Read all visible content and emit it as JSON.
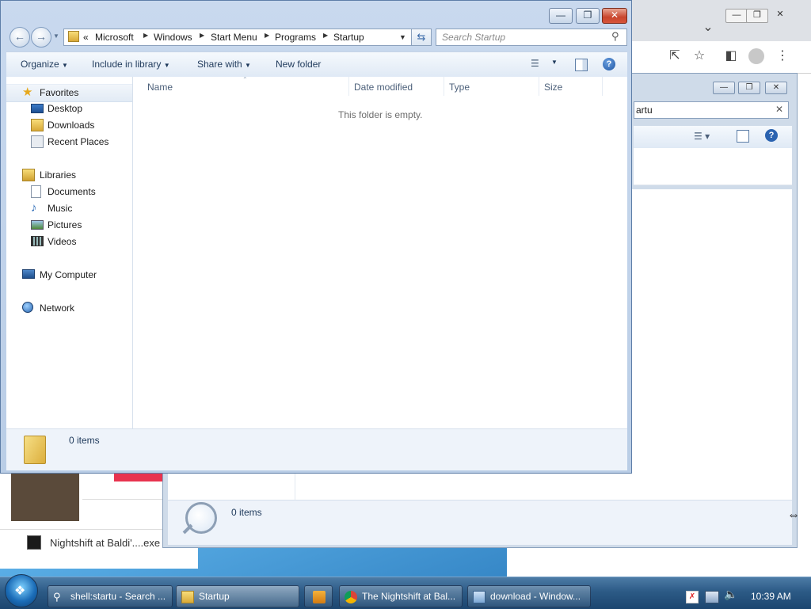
{
  "chrome": {
    "new_tab_icon": "chevron-down-icon",
    "toolbar_icons": [
      "share-icon",
      "star-icon",
      "sidepanel-icon",
      "profile-icon",
      "menu-icon"
    ]
  },
  "search_window": {
    "search_value": "artu",
    "status_text": "0 items"
  },
  "downloads_bar": {
    "item_label": "Nightshift at Baldi'....exe"
  },
  "explorer": {
    "breadcrumb": [
      "Microsoft",
      "Windows",
      "Start Menu",
      "Programs",
      "Startup"
    ],
    "breadcrumb_prefix": "«",
    "search_placeholder": "Search Startup",
    "toolbar": {
      "organize": "Organize",
      "include": "Include in library",
      "share": "Share with",
      "new_folder": "New folder"
    },
    "nav": {
      "favorites": "Favorites",
      "desktop": "Desktop",
      "downloads": "Downloads",
      "recent": "Recent Places",
      "libraries": "Libraries",
      "documents": "Documents",
      "music": "Music",
      "pictures": "Pictures",
      "videos": "Videos",
      "computer": "My Computer",
      "network": "Network"
    },
    "columns": [
      "Name",
      "Date modified",
      "Type",
      "Size"
    ],
    "empty_text": "This folder is empty.",
    "status_text": "0 items"
  },
  "taskbar": {
    "buttons": [
      {
        "label": "shell:startu - Search ...",
        "icon": "search-icon"
      },
      {
        "label": "Startup",
        "icon": "folder-icon"
      },
      {
        "label": "",
        "icon": "media-player-icon"
      },
      {
        "label": "The Nightshift at Bal...",
        "icon": "chrome-icon"
      },
      {
        "label": "download - Window...",
        "icon": "explorer-icon"
      }
    ],
    "clock": "10:39 AM"
  },
  "colors": {
    "accent": "#1e395b",
    "close_red": "#c8452d"
  }
}
